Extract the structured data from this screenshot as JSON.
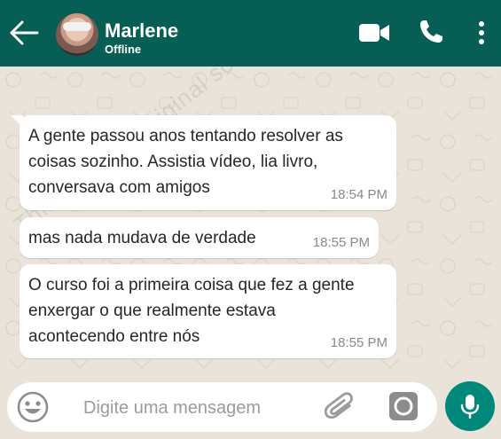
{
  "header": {
    "contact_name": "Marlene",
    "status": "Offline"
  },
  "watermark": "This is not an original screenshot!!!",
  "messages": [
    {
      "text": "A gente passou anos tentando resolver as coisas sozinho. Assistia vídeo, lia livro, conversava com amigos",
      "time": "18:54 PM"
    },
    {
      "text": "mas nada mudava de verdade",
      "time": "18:55 PM"
    },
    {
      "text": "O curso foi a primeira coisa que fez a gente enxergar o que realmente estava acontecendo entre nós",
      "time": "18:55 PM"
    }
  ],
  "composer": {
    "placeholder": "Digite uma mensagem"
  },
  "icons": {
    "back": "arrow-left-icon",
    "video": "video-camera-icon",
    "phone": "phone-icon",
    "menu": "more-vertical-icon",
    "emoji": "emoji-icon",
    "attach": "paperclip-icon",
    "camera": "camera-icon",
    "mic": "microphone-icon"
  },
  "colors": {
    "header": "#075e54",
    "chat_background": "#e9e3da",
    "bubble": "#ffffff",
    "mic_button": "#00897b"
  }
}
